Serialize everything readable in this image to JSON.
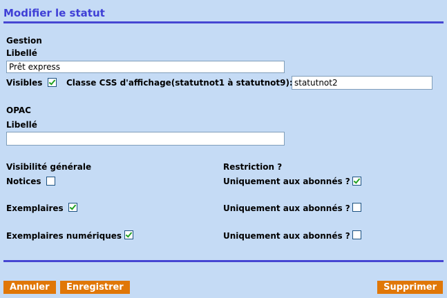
{
  "header": {
    "title": "Modifier le statut"
  },
  "gestion": {
    "section_label": "Gestion",
    "libelle_label": "Libellé",
    "libelle_value": "Prêt express",
    "visibles_label": "Visibles",
    "visibles_checked": true,
    "css_label": "Classe CSS d'affichage(statutnot1 à statutnot9):",
    "css_value": "statutnot2"
  },
  "opac": {
    "section_label": "OPAC",
    "libelle_label": "Libellé",
    "libelle_value": ""
  },
  "visibility": {
    "header": "Visibilité générale",
    "restriction_header": "Restriction ?",
    "rows": [
      {
        "label": "Notices",
        "checked": false,
        "restriction_label": "Uniquement aux abonnés ?",
        "restriction_checked": true
      },
      {
        "label": "Exemplaires",
        "checked": true,
        "restriction_label": "Uniquement aux abonnés ?",
        "restriction_checked": false
      },
      {
        "label": "Exemplaires numériques",
        "checked": true,
        "restriction_label": "Uniquement aux abonnés ?",
        "restriction_checked": false
      }
    ]
  },
  "actions": {
    "cancel": "Annuler",
    "save": "Enregistrer",
    "delete": "Supprimer"
  },
  "colors": {
    "background": "#c5dbf5",
    "title": "#3f3fd6",
    "rule": "#4646d2",
    "button": "#e07708",
    "check": "#21a121"
  }
}
